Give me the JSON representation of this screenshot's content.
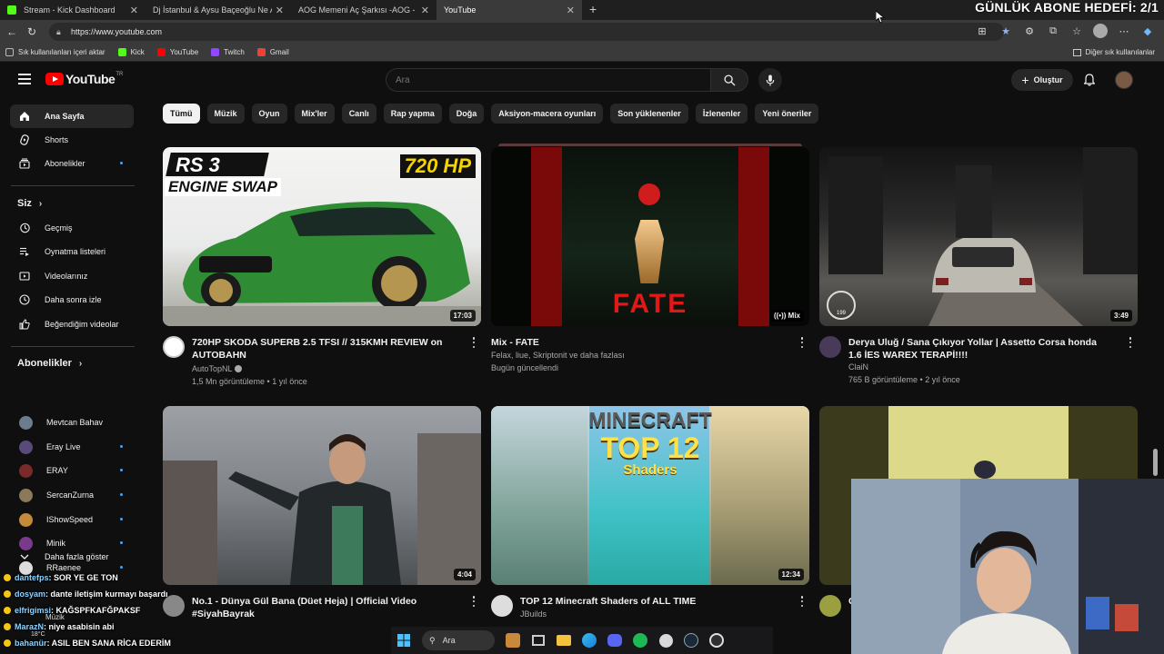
{
  "browser": {
    "tabs": [
      {
        "label": "Stream - Kick Dashboard",
        "icon": "kick-icon"
      },
      {
        "label": "Dj İstanbul & Aysu Baçeoğlu Ne A",
        "icon": "youtube-icon"
      },
      {
        "label": "AOG Memeni Aç Şarkısı -AOG - Y",
        "icon": "youtube-icon"
      },
      {
        "label": "YouTube",
        "icon": "youtube-icon"
      }
    ],
    "url": "https://www.youtube.com",
    "bookmarks": [
      {
        "label": "Sık kullanılanları içeri aktar",
        "color": "#bbbbbb"
      },
      {
        "label": "Kick",
        "color": "#53fc18"
      },
      {
        "label": "YouTube",
        "color": "#ff0000"
      },
      {
        "label": "Twitch",
        "color": "#9146ff"
      },
      {
        "label": "Gmail",
        "color": "#ea4335"
      }
    ],
    "bookmarks_other": "Diğer sık kullanılanlar"
  },
  "overlay": {
    "goal_text": "GÜNLÜK ABONE HEDEFİ: 2/1"
  },
  "youtube": {
    "logo_text": "YouTube",
    "logo_country": "TR",
    "search_placeholder": "Ara",
    "create_label": "Oluştur",
    "sidebar": {
      "main": [
        {
          "label": "Ana Sayfa",
          "icon": "home-icon",
          "active": true
        },
        {
          "label": "Shorts",
          "icon": "shorts-icon"
        },
        {
          "label": "Abonelikler",
          "icon": "subscriptions-icon",
          "dot": true
        }
      ],
      "you_heading": "Siz",
      "you": [
        {
          "label": "Geçmiş",
          "icon": "history-icon"
        },
        {
          "label": "Oynatma listeleri",
          "icon": "playlists-icon"
        },
        {
          "label": "Videolarınız",
          "icon": "your-videos-icon"
        },
        {
          "label": "Daha sonra izle",
          "icon": "watch-later-icon"
        },
        {
          "label": "Beğendiğim videolar",
          "icon": "liked-videos-icon"
        }
      ],
      "subs_heading": "Abonelikler",
      "subs": [
        {
          "label": "Mevtcan Bahav",
          "color": "#6b7d8c",
          "dot": false
        },
        {
          "label": "Eray Live",
          "color": "#5a4a7a",
          "dot": true
        },
        {
          "label": "ERAY",
          "color": "#7a2a2a",
          "dot": true
        },
        {
          "label": "SercanZurna",
          "color": "#8a7a5a",
          "dot": true
        },
        {
          "label": "IShowSpeed",
          "color": "#c58a3a",
          "dot": true
        },
        {
          "label": "Minik",
          "color": "#7a3a8a",
          "dot": true
        },
        {
          "label": "RRaenee",
          "color": "#dddddd",
          "dot": true
        }
      ],
      "show_more": "Daha fazla göster"
    },
    "chips": [
      "Tümü",
      "Müzik",
      "Oyun",
      "Mix'ler",
      "Canlı",
      "Rap yapma",
      "Doğa",
      "Aksiyon-macera oyunları",
      "Son yüklenenler",
      "İzlenenler",
      "Yeni öneriler"
    ],
    "videos": [
      {
        "title": "720HP SKODA SUPERB 2.5 TFSI // 315KMH REVIEW on AUTOBAHN",
        "channel": "AutoTopNL",
        "verified": true,
        "stats": "1,5 Mn görüntüleme • 1 yıl önce",
        "duration": "17:03",
        "thumb_text_a": "RS 3",
        "thumb_text_b": "ENGINE SWAP",
        "thumb_text_c": "720 HP"
      },
      {
        "title": "Mix - FATE",
        "channel": "Felax, liue, Skriptonit ve daha fazlası",
        "stats": "Bugün güncellendi",
        "duration": "Mix",
        "thumb_text_a": "FATE"
      },
      {
        "title": "Derya Uluğ / Sana Çıkıyor Yollar | Assetto Corsa honda 1.6 İES WAREX TERAPİ!!!!",
        "channel": "ClaiN",
        "stats": "765 B görüntüleme • 2 yıl önce",
        "duration": "3:49",
        "thumb_text_a": "199"
      },
      {
        "title": "No.1 - Dünya Gül Bana (Düet Heja) | Official Video #SiyahBayrak",
        "duration": "4:04"
      },
      {
        "title": "TOP 12 Minecraft Shaders of ALL TIME",
        "channel": "JBuilds",
        "duration": "12:34",
        "thumb_text_a": "MINECRAFT",
        "thumb_text_b": "TOP 12",
        "thumb_text_c": "Shaders"
      },
      {
        "title": "C"
      }
    ]
  },
  "chat": [
    {
      "name": "dantefps",
      "msg": ": SOR YE GE TON"
    },
    {
      "name": "dosyam",
      "msg": ": dante iletişim kurmayı başardı"
    },
    {
      "name": "elfrigimsi",
      "msg": ": KAĞSPFKAFĞPAKSF"
    },
    {
      "name": "MarazN",
      "msg": ": niye asabisin abi"
    },
    {
      "name": "bahanür",
      "msg": ": ASIL BEN SANA RİCA EDERİM"
    }
  ],
  "chat_extra": {
    "muzik": "Müzik",
    "temp": "18°C"
  },
  "taskbar": {
    "search_label": "Ara"
  }
}
